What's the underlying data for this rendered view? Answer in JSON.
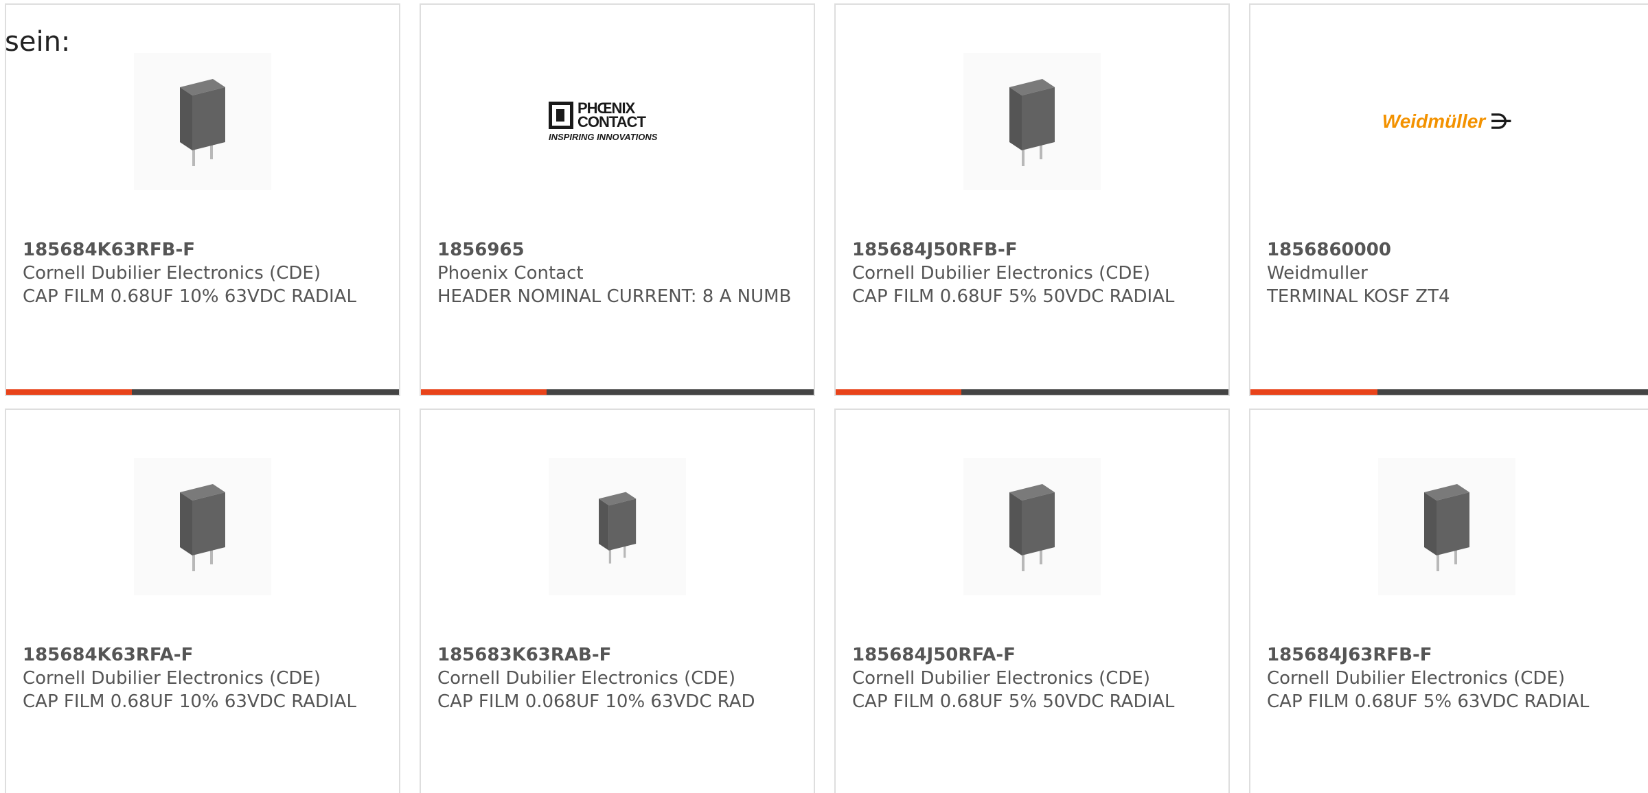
{
  "intro_text": "sein:",
  "colors": {
    "accent": "#e8431a",
    "bar": "#444444",
    "border": "#dedede",
    "text": "#555555",
    "weidmuller_orange": "#f39200"
  },
  "products": [
    {
      "part_number": "185684K63RFB-F",
      "manufacturer": "Cornell Dubilier Electronics (CDE)",
      "description": "CAP FILM 0.68UF 10% 63VDC RADIAL",
      "image": "capacitor-image",
      "progress": 0.32
    },
    {
      "part_number": "1856965",
      "manufacturer": "Phoenix Contact",
      "description": "HEADER NOMINAL CURRENT: 8 A NUMB",
      "image": "phoenix-contact-logo",
      "logo_text": [
        "PHŒNIX",
        "CONTACT"
      ],
      "logo_tagline": "INSPIRING INNOVATIONS",
      "progress": 0.32
    },
    {
      "part_number": "185684J50RFB-F",
      "manufacturer": "Cornell Dubilier Electronics (CDE)",
      "description": "CAP FILM 0.68UF 5% 50VDC RADIAL",
      "image": "capacitor-image",
      "progress": 0.32
    },
    {
      "part_number": "1856860000",
      "manufacturer": "Weidmuller",
      "description": "TERMINAL KOSF ZT4",
      "image": "weidmuller-logo",
      "logo_text": "Weidmüller",
      "progress": 0.32
    },
    {
      "part_number": "185684K63RFA-F",
      "manufacturer": "Cornell Dubilier Electronics (CDE)",
      "description": "CAP FILM 0.68UF 10% 63VDC RADIAL",
      "image": "capacitor-image"
    },
    {
      "part_number": "185683K63RAB-F",
      "manufacturer": "Cornell Dubilier Electronics (CDE)",
      "description": "CAP FILM 0.068UF 10% 63VDC RAD",
      "image": "capacitor-image"
    },
    {
      "part_number": "185684J50RFA-F",
      "manufacturer": "Cornell Dubilier Electronics (CDE)",
      "description": "CAP FILM 0.68UF 5% 50VDC RADIAL",
      "image": "capacitor-image"
    },
    {
      "part_number": "185684J63RFB-F",
      "manufacturer": "Cornell Dubilier Electronics (CDE)",
      "description": "CAP FILM 0.68UF 5% 63VDC RADIAL",
      "image": "capacitor-image"
    }
  ]
}
